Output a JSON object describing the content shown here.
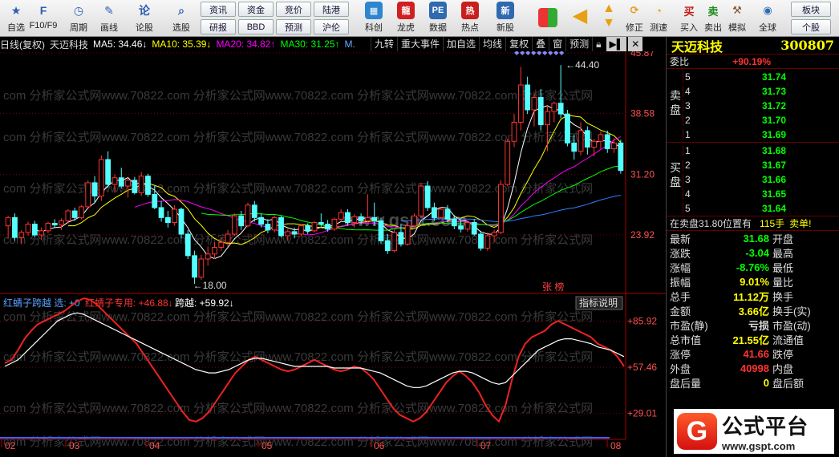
{
  "toolbar": {
    "left_items": [
      {
        "label": "自选",
        "icon": "star-icon",
        "color": "#2b5fb4"
      },
      {
        "label": "F10/F9",
        "icon": "document-icon",
        "color": "#2b5fb4"
      },
      {
        "label": "周期",
        "icon": "clock-icon",
        "color": "#2b5fb4"
      },
      {
        "label": "画线",
        "icon": "pen-icon",
        "color": "#2b5fb4"
      },
      {
        "label": "论股",
        "icon": "discussion-icon",
        "color": "#2b5fb4"
      },
      {
        "label": "选股",
        "icon": "magnifier-icon",
        "color": "#2b5fb4"
      }
    ],
    "grid_buttons": [
      "资讯",
      "资金",
      "竞价",
      "陆港",
      "研报",
      "BBD",
      "预测",
      "沪伦"
    ],
    "mid_items": [
      {
        "label": "科创",
        "icon": "chart-icon",
        "color": "#2f86d0"
      },
      {
        "label": "龙虎",
        "icon": "dragon-icon",
        "color": "#d02020"
      },
      {
        "label": "数据",
        "icon": "pe-icon",
        "color": "#2f6ab0"
      },
      {
        "label": "热点",
        "icon": "hot-icon",
        "color": "#c81e1e"
      },
      {
        "label": "新股",
        "icon": "ipo-icon",
        "color": "#2f6ab0"
      }
    ],
    "right_items": [
      {
        "label": "修正",
        "icon": "refresh-icon",
        "color": "#e0a020"
      },
      {
        "label": "测速",
        "icon": "stopwatch-icon",
        "color": "#e0a020"
      },
      {
        "label": "买入",
        "icon": "buy-icon",
        "color": "#c01818"
      },
      {
        "label": "卖出",
        "icon": "sell-icon",
        "color": "#1e8a1e"
      },
      {
        "label": "模拟",
        "icon": "hammer-icon",
        "color": "#8a5020"
      },
      {
        "label": "全球",
        "icon": "globe-icon",
        "color": "#2f6ab0"
      }
    ],
    "corner_buttons": [
      "板块",
      "个股"
    ]
  },
  "chart_header": {
    "period": "日线(复权)",
    "stock_name": "天迈科技",
    "ma5": "MA5: 34.46↓",
    "ma10": "MA10: 35.39↓",
    "ma20": "MA20: 34.82↑",
    "ma30": "MA30: 31.25↑",
    "extra": "M."
  },
  "chart_controls": [
    "九转",
    "重大事件",
    "加自选",
    "均线",
    "复权",
    "叠",
    "窗",
    "预测"
  ],
  "indicator_header": {
    "name": "红蜻子跨越",
    "select": "选: +0",
    "special": "红蜻子专用: +46.88↓",
    "cross": "跨越: +59.92↓",
    "help": "指标说明"
  },
  "annotations": {
    "high": "44.40",
    "low": "18.00",
    "zhangbang": "张 榜",
    "watermark": "www.gspt.com",
    "watermark_line": "com 分析家公式网www.70822.com 分析家公式网www.70822.com 分析家公式网www.70822.com 分析家公式网"
  },
  "chart_data": [
    {
      "type": "candlestick",
      "title": "天迈科技 日线(复权)",
      "ylim": [
        18.0,
        45.87
      ],
      "y_ticks": [
        "45.87",
        "38.58",
        "31.20",
        "23.92"
      ],
      "x_ticks": [
        "02",
        "03",
        "04",
        "05",
        "06",
        "07",
        "08"
      ],
      "up_color": "#ff3232",
      "down_color": "#54ffff",
      "candles": [
        [
          25.0,
          26.2,
          23.5,
          26.0
        ],
        [
          26.0,
          26.5,
          23.2,
          23.6
        ],
        [
          23.6,
          24.5,
          22.8,
          24.2
        ],
        [
          24.2,
          25.5,
          23.8,
          25.2
        ],
        [
          25.2,
          25.6,
          23.6,
          23.9
        ],
        [
          23.9,
          24.8,
          23.3,
          24.4
        ],
        [
          24.4,
          25.5,
          24.1,
          25.3
        ],
        [
          25.3,
          25.8,
          24.8,
          25.1
        ],
        [
          25.1,
          25.9,
          24.5,
          25.6
        ],
        [
          25.6,
          27.0,
          25.3,
          26.8
        ],
        [
          26.8,
          27.2,
          25.6,
          26.0
        ],
        [
          26.0,
          27.5,
          25.8,
          27.3
        ],
        [
          27.3,
          30.5,
          27.0,
          30.2
        ],
        [
          30.2,
          31.0,
          27.8,
          28.6
        ],
        [
          28.6,
          33.5,
          28.0,
          33.0
        ],
        [
          33.0,
          34.0,
          29.6,
          30.0
        ],
        [
          30.0,
          31.2,
          29.0,
          30.8
        ],
        [
          30.8,
          32.0,
          29.5,
          29.8
        ],
        [
          29.8,
          30.8,
          28.4,
          30.5
        ],
        [
          30.5,
          30.9,
          28.8,
          29.0
        ],
        [
          29.0,
          31.5,
          28.6,
          31.0
        ],
        [
          31.0,
          31.3,
          28.5,
          28.8
        ],
        [
          28.8,
          29.8,
          27.0,
          27.2
        ],
        [
          27.2,
          28.0,
          25.5,
          26.0
        ],
        [
          26.0,
          26.8,
          24.8,
          25.4
        ],
        [
          25.4,
          27.5,
          25.0,
          27.0
        ],
        [
          27.0,
          27.2,
          23.5,
          24.0
        ],
        [
          24.0,
          24.5,
          21.0,
          21.4
        ],
        [
          21.4,
          22.0,
          18.0,
          18.8
        ],
        [
          18.8,
          21.5,
          18.5,
          21.0
        ],
        [
          21.0,
          22.5,
          20.2,
          21.6
        ],
        [
          21.6,
          23.0,
          21.0,
          22.4
        ],
        [
          22.4,
          23.6,
          22.0,
          23.0
        ],
        [
          23.0,
          24.5,
          22.5,
          24.0
        ],
        [
          24.0,
          26.5,
          23.8,
          26.2
        ],
        [
          26.2,
          26.8,
          24.5,
          25.0
        ],
        [
          25.0,
          27.8,
          24.8,
          27.5
        ],
        [
          27.5,
          28.0,
          25.5,
          26.0
        ],
        [
          26.0,
          26.5,
          24.8,
          25.2
        ],
        [
          25.2,
          25.8,
          24.1,
          24.5
        ],
        [
          24.5,
          26.3,
          24.2,
          26.0
        ],
        [
          26.0,
          26.2,
          23.6,
          23.8
        ],
        [
          23.8,
          24.6,
          23.2,
          24.3
        ],
        [
          24.3,
          24.8,
          23.5,
          24.0
        ],
        [
          24.0,
          25.2,
          23.7,
          25.0
        ],
        [
          25.0,
          25.3,
          24.0,
          24.4
        ],
        [
          24.4,
          25.6,
          24.2,
          25.4
        ],
        [
          25.4,
          26.5,
          24.8,
          25.2
        ],
        [
          25.2,
          25.7,
          24.3,
          24.6
        ],
        [
          24.6,
          26.0,
          24.4,
          25.8
        ],
        [
          25.8,
          27.0,
          25.5,
          26.6
        ],
        [
          26.6,
          27.0,
          25.1,
          25.4
        ],
        [
          25.4,
          26.4,
          24.8,
          26.1
        ],
        [
          26.1,
          26.5,
          25.2,
          25.6
        ],
        [
          25.6,
          28.8,
          25.4,
          26.0
        ],
        [
          26.0,
          27.8,
          25.0,
          25.6
        ],
        [
          25.6,
          26.0,
          22.8,
          23.2
        ],
        [
          23.2,
          24.0,
          21.6,
          22.0
        ],
        [
          22.0,
          24.5,
          21.8,
          24.2
        ],
        [
          24.2,
          25.2,
          22.5,
          22.8
        ],
        [
          22.8,
          25.3,
          22.6,
          25.0
        ],
        [
          25.0,
          26.5,
          24.8,
          26.2
        ],
        [
          26.2,
          30.2,
          26.0,
          29.8
        ],
        [
          29.8,
          30.4,
          26.8,
          27.2
        ],
        [
          27.2,
          27.8,
          25.6,
          26.0
        ],
        [
          26.0,
          27.3,
          25.8,
          27.0
        ],
        [
          27.0,
          27.5,
          25.4,
          25.8
        ],
        [
          25.8,
          26.3,
          24.6,
          25.0
        ],
        [
          25.0,
          25.6,
          24.2,
          24.6
        ],
        [
          24.6,
          25.6,
          24.3,
          25.4
        ],
        [
          25.4,
          25.8,
          23.8,
          24.0
        ],
        [
          24.0,
          24.4,
          22.0,
          22.3
        ],
        [
          22.3,
          24.2,
          22.0,
          23.8
        ],
        [
          23.8,
          24.5,
          23.0,
          24.2
        ],
        [
          24.2,
          30.5,
          24.0,
          30.0
        ],
        [
          30.0,
          35.5,
          29.8,
          35.2
        ],
        [
          35.2,
          38.5,
          34.5,
          37.5
        ],
        [
          37.5,
          44.2,
          36.5,
          42.0
        ],
        [
          42.0,
          43.0,
          38.5,
          39.0
        ],
        [
          39.0,
          41.0,
          37.0,
          40.5
        ],
        [
          40.5,
          41.5,
          36.5,
          37.2
        ],
        [
          37.2,
          39.5,
          34.0,
          38.8
        ],
        [
          38.8,
          40.0,
          37.5,
          39.8
        ],
        [
          39.8,
          44.4,
          38.0,
          38.5
        ],
        [
          38.5,
          39.0,
          34.6,
          35.0
        ],
        [
          35.0,
          36.0,
          33.0,
          34.0
        ],
        [
          34.0,
          37.5,
          33.5,
          36.5
        ],
        [
          36.5,
          37.0,
          33.6,
          34.5
        ],
        [
          34.5,
          35.5,
          33.4,
          35.2
        ],
        [
          35.2,
          36.4,
          34.3,
          36.0
        ],
        [
          36.0,
          36.5,
          33.8,
          34.3
        ],
        [
          34.3,
          35.6,
          33.8,
          35.0
        ],
        [
          35.0,
          35.4,
          31.3,
          31.68
        ]
      ]
    },
    {
      "type": "line",
      "title": "红蜻子跨越",
      "ylim": [
        15.0,
        100.0
      ],
      "y_ticks": [
        "+85.92",
        "+57.46",
        "+29.01"
      ],
      "series": [
        {
          "name": "红蜻子专用",
          "color": "#ee2222",
          "values": [
            60,
            62,
            68,
            75,
            80,
            84,
            86,
            88,
            90,
            92,
            95,
            98,
            100,
            99,
            96,
            92,
            88,
            84,
            80,
            76,
            72,
            66,
            60,
            54,
            48,
            42,
            36,
            30,
            25,
            24,
            26,
            30,
            36,
            42,
            48,
            54,
            58,
            62,
            64,
            62,
            60,
            58,
            56,
            55,
            56,
            58,
            60,
            62,
            60,
            58,
            56,
            55,
            56,
            58,
            57,
            54,
            50,
            44,
            38,
            32,
            28,
            26,
            24,
            26,
            30,
            36,
            42,
            48,
            52,
            55,
            52,
            48,
            42,
            34,
            28,
            24,
            34,
            50,
            64,
            72,
            76,
            78,
            80,
            84,
            86,
            84,
            82,
            80,
            78,
            76,
            72,
            70,
            68,
            64,
            58
          ]
        },
        {
          "name": "跨越",
          "color": "#ffffff",
          "values": [
            58,
            60,
            62,
            66,
            70,
            74,
            78,
            82,
            86,
            88,
            90,
            91,
            90,
            88,
            86,
            84,
            82,
            80,
            78,
            76,
            74,
            72,
            70,
            68,
            66,
            64,
            62,
            60,
            58,
            56,
            55,
            54,
            54,
            55,
            56,
            58,
            60,
            62,
            63,
            63,
            62,
            61,
            60,
            59,
            58,
            58,
            58,
            58,
            58,
            58,
            57,
            57,
            57,
            57,
            57,
            56,
            55,
            54,
            52,
            50,
            48,
            46,
            45,
            45,
            46,
            48,
            50,
            52,
            54,
            55,
            55,
            54,
            52,
            50,
            48,
            47,
            48,
            52,
            56,
            60,
            64,
            68,
            70,
            72,
            74,
            75,
            75,
            74,
            73,
            72,
            70,
            69,
            68,
            66,
            64
          ]
        }
      ]
    }
  ],
  "quote_panel": {
    "name": "天迈科技",
    "code": "300807",
    "weibi_label": "委比",
    "weibi_value": "+90.19%",
    "sell_label": "卖 盘",
    "buy_label": "买 盘",
    "sell": [
      {
        "idx": "5",
        "price": "31.74"
      },
      {
        "idx": "4",
        "price": "31.73"
      },
      {
        "idx": "3",
        "price": "31.72"
      },
      {
        "idx": "2",
        "price": "31.70"
      },
      {
        "idx": "1",
        "price": "31.69"
      }
    ],
    "buy": [
      {
        "idx": "1",
        "price": "31.68"
      },
      {
        "idx": "2",
        "price": "31.67"
      },
      {
        "idx": "3",
        "price": "31.66"
      },
      {
        "idx": "4",
        "price": "31.65"
      },
      {
        "idx": "5",
        "price": "31.64"
      }
    ],
    "trade_note": "在卖盘31.80位置有",
    "trade_qty": "115手",
    "trade_type": "卖单!",
    "stats": [
      {
        "l1": "最新",
        "v": "31.68",
        "c": "grn",
        "l2": "开盘"
      },
      {
        "l1": "涨跌",
        "v": "-3.04",
        "c": "grn",
        "l2": "最高"
      },
      {
        "l1": "涨幅",
        "v": "-8.76%",
        "c": "grn",
        "l2": "最低"
      },
      {
        "l1": "振幅",
        "v": "9.01%",
        "c": "yel",
        "l2": "量比"
      },
      {
        "l1": "总手",
        "v": "11.12万",
        "c": "yel",
        "l2": "换手"
      },
      {
        "l1": "金额",
        "v": "3.66亿",
        "c": "yel",
        "l2": "换手(实)"
      },
      {
        "l1": "市盈(静)",
        "v": "亏损",
        "c": "wht",
        "l2": "市盈(动)"
      },
      {
        "l1": "总市值",
        "v": "21.55亿",
        "c": "yel",
        "l2": "流通值"
      },
      {
        "l1": "涨停",
        "v": "41.66",
        "c": "red",
        "l2": "跌停"
      },
      {
        "l1": "外盘",
        "v": "40998",
        "c": "red",
        "l2": "内盘"
      },
      {
        "l1": "盘后量",
        "v": "0",
        "c": "yel",
        "l2": "盘后额"
      }
    ]
  },
  "logo": {
    "text": "公式平台",
    "url_text": "www.gspt.com"
  }
}
